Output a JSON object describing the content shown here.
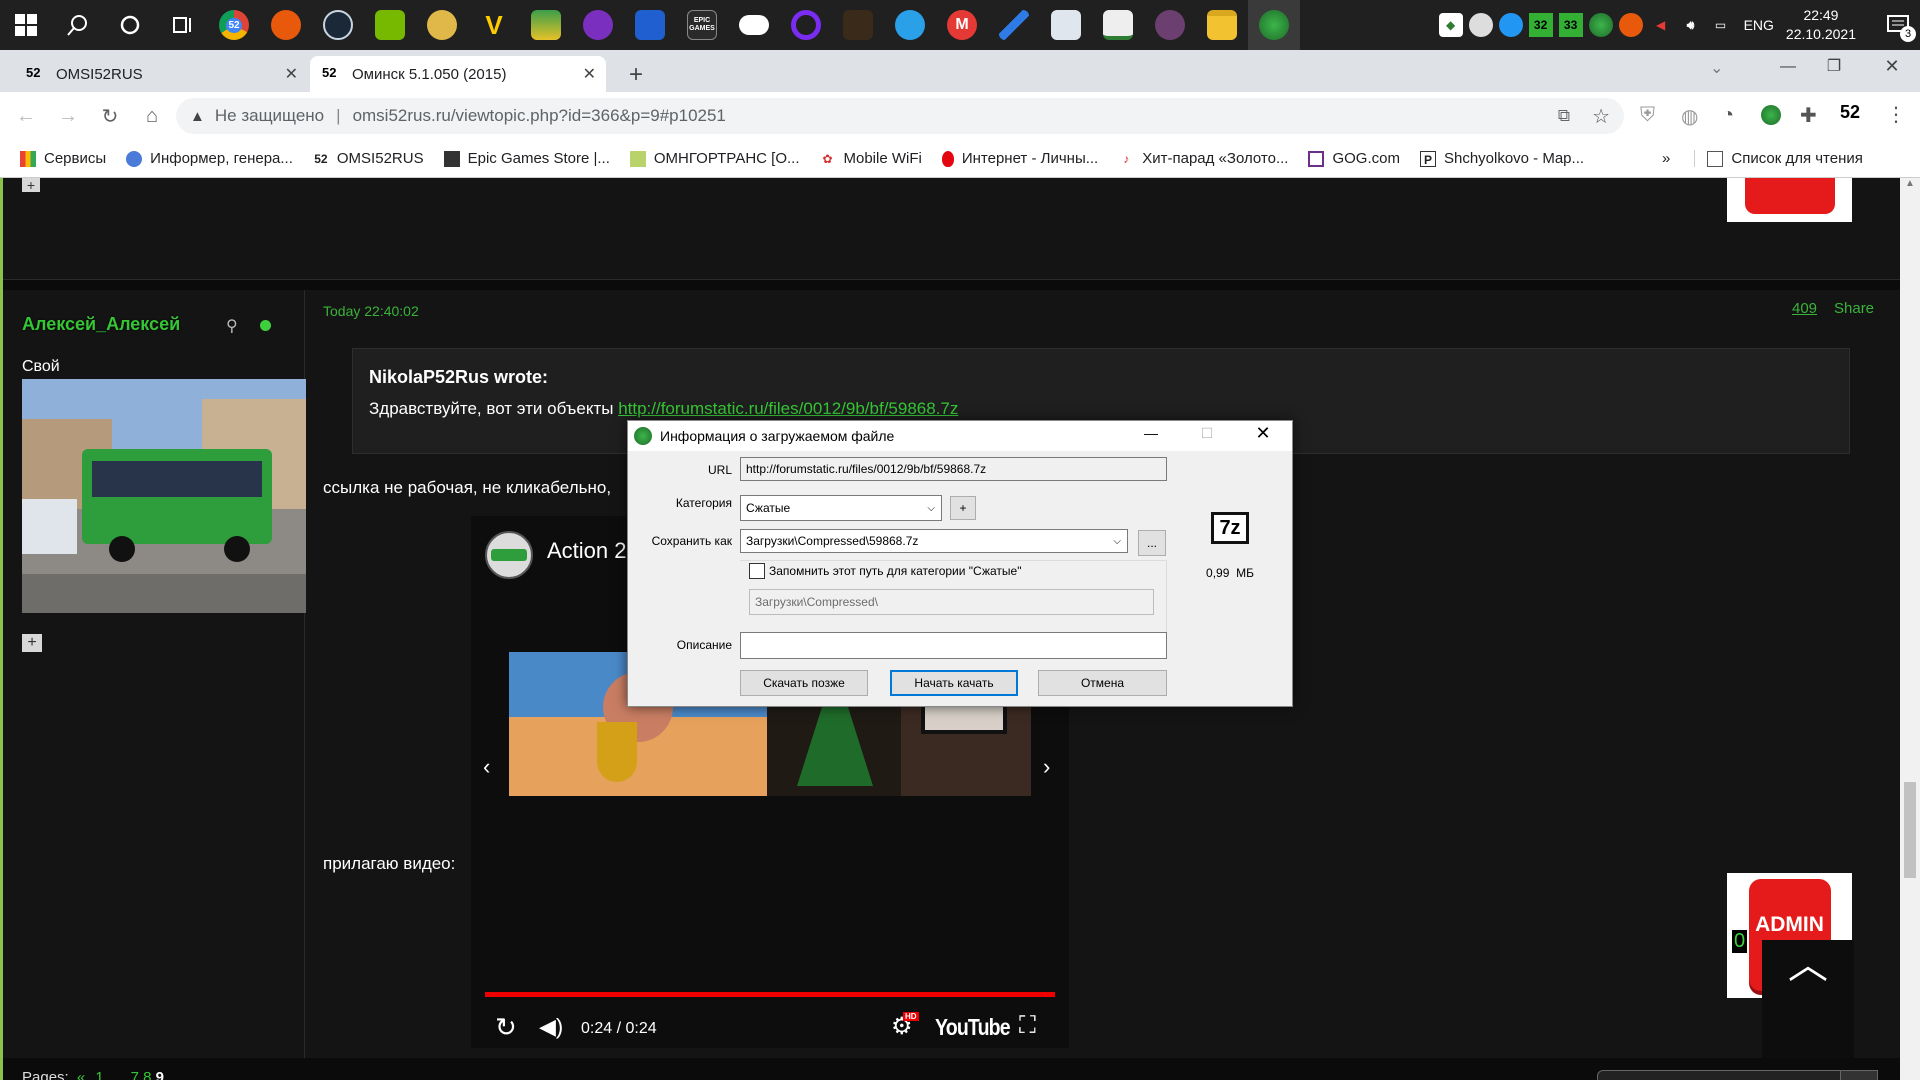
{
  "taskbar": {
    "clock_time": "22:49",
    "clock_date": "22.10.2021",
    "lang": "ENG",
    "notif_count": "3",
    "apps": [
      "52",
      "",
      "",
      "",
      "",
      "V",
      "",
      "",
      "",
      "EPIC GAMES",
      "",
      "",
      "",
      "",
      "M",
      "",
      "",
      "",
      "",
      "",
      "",
      ""
    ],
    "tray_nums": [
      "32",
      "33"
    ]
  },
  "tabs": [
    {
      "fav": "52",
      "title": "OMSI52RUS"
    },
    {
      "fav": "52",
      "title": "Оминск 5.1.050 (2015)"
    }
  ],
  "address": {
    "security": "Не защищено",
    "url": "omsi52rus.ru/viewtopic.php?id=366&p=9#p10251",
    "ext_badge": "52"
  },
  "bookmarks": [
    {
      "icon": "apps",
      "label": "Сервисы"
    },
    {
      "icon": "globe",
      "label": "Информер, генера..."
    },
    {
      "icon": "52",
      "label": "OMSI52RUS"
    },
    {
      "icon": "epic",
      "label": "Epic Games Store |..."
    },
    {
      "icon": "omn",
      "label": "ОМНГОРТРАНС [О..."
    },
    {
      "icon": "huawei",
      "label": "Mobile WiFi"
    },
    {
      "icon": "mts",
      "label": "Интернет - Личны..."
    },
    {
      "icon": "mic",
      "label": "Хит-парад «Золото..."
    },
    {
      "icon": "gog",
      "label": "GOG.com"
    },
    {
      "icon": "P",
      "label": "Shchyolkovo - Map..."
    }
  ],
  "bookmarks_more": "»",
  "reading_list": "Список для чтения",
  "post": {
    "author": "Алексей_Алексей",
    "status": "Свой",
    "time": "Today 22:40:02",
    "num": "409",
    "share": "Share",
    "quote_author": "NikolaP52Rus wrote:",
    "quote_text": "Здравствуйте, вот эти объекты ",
    "quote_link": "http://forumstatic.ru/files/0012/9b/bf/59868.7z",
    "reply_text": "ссылка не рабочая, не кликабельно,",
    "video_label": "прилагаю видео:"
  },
  "video": {
    "title": "Action 2",
    "time": "0:24 / 0:24",
    "brand": "YouTube",
    "hd": "HD",
    "progress": 1.0
  },
  "admin_badge": "ADMIN",
  "counter": "0",
  "pagination": {
    "label": "Pages:",
    "prev": "«",
    "p1": "1",
    "gap": "...",
    "p7": "7",
    "p8": "8",
    "p9": "9"
  },
  "dialog": {
    "title": "Информация о загружаемом файле",
    "url_label": "URL",
    "url_value": "http://forumstatic.ru/files/0012/9b/bf/59868.7z",
    "category_label": "Категория",
    "category_value": "Сжатые",
    "add_btn": "+",
    "save_label": "Сохранить как",
    "save_value": "Загрузки\\Compressed\\59868.7z",
    "browse_btn": "...",
    "remember_label": "Запомнить этот путь для категории \"Сжатые\"",
    "remember_checked": false,
    "path_value": "Загрузки\\Compressed\\",
    "desc_label": "Описание",
    "desc_value": "",
    "later_btn": "Скачать позже",
    "start_btn": "Начать качать",
    "cancel_btn": "Отмена",
    "file_icon": "7z",
    "size": "0,99  МБ"
  }
}
